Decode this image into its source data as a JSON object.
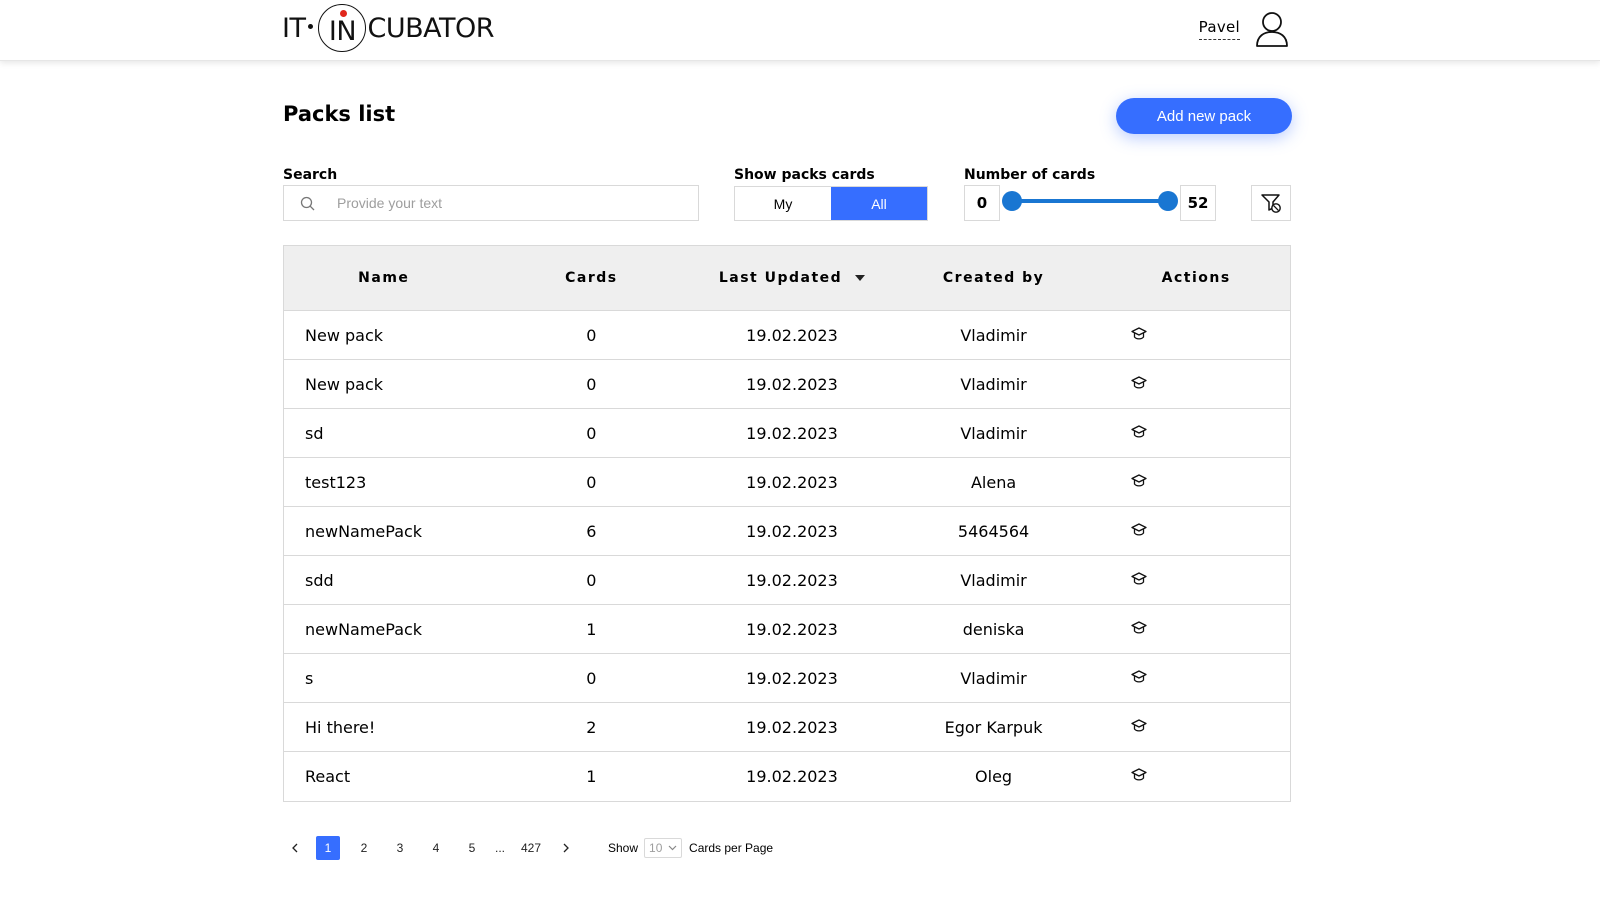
{
  "header": {
    "logo": {
      "part1": "IT",
      "part2": "IN",
      "part3": "CUBATOR"
    },
    "user_name": "Pavel"
  },
  "page": {
    "title": "Packs list",
    "add_button": "Add new pack"
  },
  "filters": {
    "search_label": "Search",
    "search_placeholder": "Provide your text",
    "search_value": "",
    "show_label": "Show packs cards",
    "show_options": [
      "My",
      "All"
    ],
    "show_selected": "All",
    "number_label": "Number of cards",
    "min_value": "0",
    "max_value": "52",
    "range_min_fraction": 0,
    "range_max_fraction": 1
  },
  "table": {
    "columns": [
      "Name",
      "Cards",
      "Last Updated",
      "Created by",
      "Actions"
    ],
    "sorted_column": "Last Updated",
    "sort_direction": "desc",
    "rows": [
      {
        "name": "New pack",
        "cards": "0",
        "updated": "19.02.2023",
        "created_by": "Vladimir"
      },
      {
        "name": "New pack",
        "cards": "0",
        "updated": "19.02.2023",
        "created_by": "Vladimir"
      },
      {
        "name": "sd",
        "cards": "0",
        "updated": "19.02.2023",
        "created_by": "Vladimir"
      },
      {
        "name": "test123",
        "cards": "0",
        "updated": "19.02.2023",
        "created_by": "Alena"
      },
      {
        "name": "newNamePack",
        "cards": "6",
        "updated": "19.02.2023",
        "created_by": "5464564"
      },
      {
        "name": "sdd",
        "cards": "0",
        "updated": "19.02.2023",
        "created_by": "Vladimir"
      },
      {
        "name": "newNamePack",
        "cards": "1",
        "updated": "19.02.2023",
        "created_by": "deniska"
      },
      {
        "name": "s",
        "cards": "0",
        "updated": "19.02.2023",
        "created_by": "Vladimir"
      },
      {
        "name": "Hi there!",
        "cards": "2",
        "updated": "19.02.2023",
        "created_by": "Egor Karpuk"
      },
      {
        "name": "React",
        "cards": "1",
        "updated": "19.02.2023",
        "created_by": "Oleg"
      }
    ],
    "action_icon": "learn-cap-icon"
  },
  "pagination": {
    "pages": [
      "1",
      "2",
      "3",
      "4",
      "5",
      "...",
      "427"
    ],
    "current": "1",
    "show_label": "Show",
    "per_page_value": "10",
    "per_page_suffix": "Cards per Page"
  },
  "colors": {
    "accent": "#366eff",
    "slider": "#1976d2",
    "header_bg": "#efefef"
  }
}
